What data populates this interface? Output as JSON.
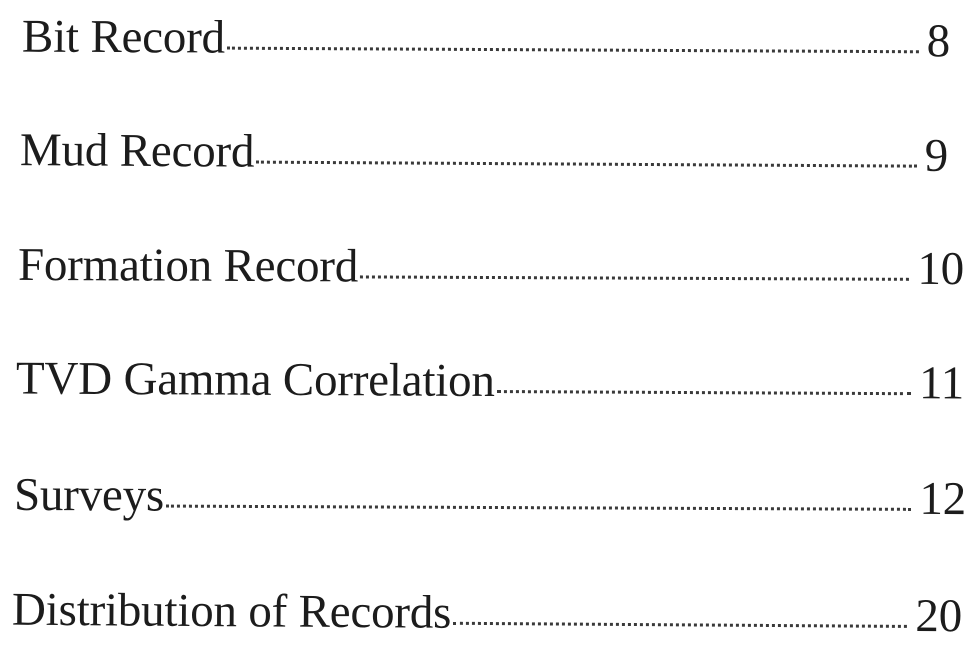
{
  "toc": {
    "entries": [
      {
        "title": "Bit Record",
        "page": "8"
      },
      {
        "title": "Mud Record",
        "page": "9"
      },
      {
        "title": "Formation Record",
        "page": "10"
      },
      {
        "title": "TVD Gamma Correlation",
        "page": "11"
      },
      {
        "title": "Surveys",
        "page": "12"
      },
      {
        "title": "Distribution of Records",
        "page": "20"
      }
    ]
  }
}
